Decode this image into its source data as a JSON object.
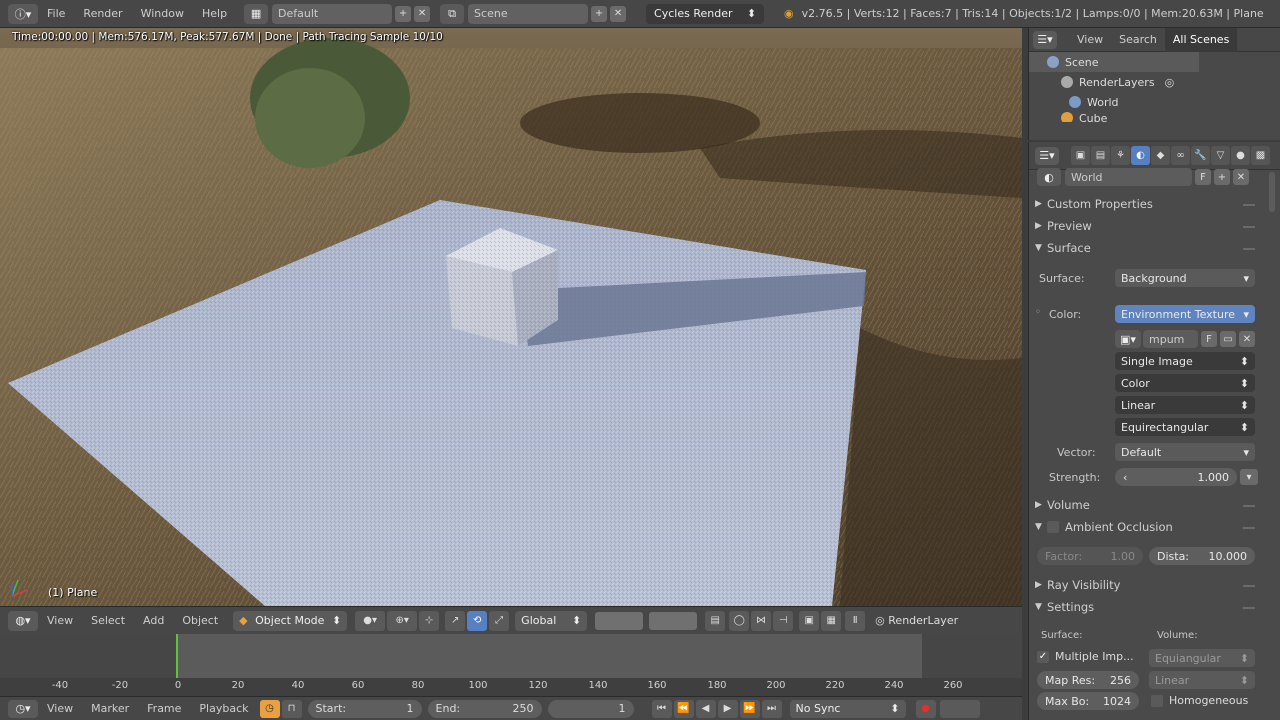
{
  "topbar": {
    "menu": [
      "File",
      "Render",
      "Window",
      "Help"
    ],
    "layout": "Default",
    "scene": "Scene",
    "engine": "Cycles Render",
    "stats": "v2.76.5 | Verts:12 | Faces:7 | Tris:14 | Objects:1/2 | Lamps:0/0 | Mem:20.63M | Plane"
  },
  "viewport": {
    "render_info": "Time:00:00.00 | Mem:576.17M, Peak:577.67M | Done | Path Tracing Sample 10/10",
    "object_label": "(1) Plane",
    "header": {
      "menu": [
        "View",
        "Select",
        "Add",
        "Object"
      ],
      "mode": "Object Mode",
      "orientation": "Global",
      "render_layer": "RenderLayer"
    }
  },
  "timeline": {
    "ticks": [
      "-40",
      "-20",
      "0",
      "20",
      "40",
      "60",
      "80",
      "100",
      "120",
      "140",
      "160",
      "180",
      "200",
      "220",
      "240",
      "260"
    ],
    "header": {
      "menu": [
        "View",
        "Marker",
        "Frame",
        "Playback"
      ],
      "start_label": "Start:",
      "start_value": "1",
      "end_label": "End:",
      "end_value": "250",
      "current_frame": "1",
      "sync": "No Sync"
    }
  },
  "outliner": {
    "tabs": [
      "View",
      "Search",
      "All Scenes"
    ],
    "rows": [
      "Scene",
      "RenderLayers",
      "World",
      "Cube"
    ]
  },
  "properties": {
    "world_name": "World",
    "world_f": "F",
    "panels": {
      "custom_properties": "Custom Properties",
      "preview": "Preview",
      "surface": "Surface",
      "volume": "Volume",
      "ambient_occlusion": "Ambient Occlusion",
      "ray_visibility": "Ray Visibility",
      "settings": "Settings"
    },
    "surface_label": "Surface:",
    "surface_value": "Background",
    "color_label": "Color:",
    "color_value": "Environment Texture",
    "image_name": "mpum",
    "image_f": "F",
    "source": "Single Image",
    "color_space": "Color",
    "interpolation": "Linear",
    "projection": "Equirectangular",
    "vector_label": "Vector:",
    "vector_value": "Default",
    "strength_label": "Strength:",
    "strength_value": "1.000",
    "factor_label": "Factor:",
    "factor_value": "1.00",
    "distance_label": "Dista:",
    "distance_value": "10.000",
    "settings_surface_label": "Surface:",
    "settings_volume_label": "Volume:",
    "multiple_importance": "Multiple Imp...",
    "map_res_label": "Map Res:",
    "map_res_value": "256",
    "max_bounces_label": "Max Bo:",
    "max_bounces_value": "1024",
    "volume_sampling": "Equiangular",
    "volume_interpolation": "Linear",
    "homogeneous": "Homogeneous"
  }
}
